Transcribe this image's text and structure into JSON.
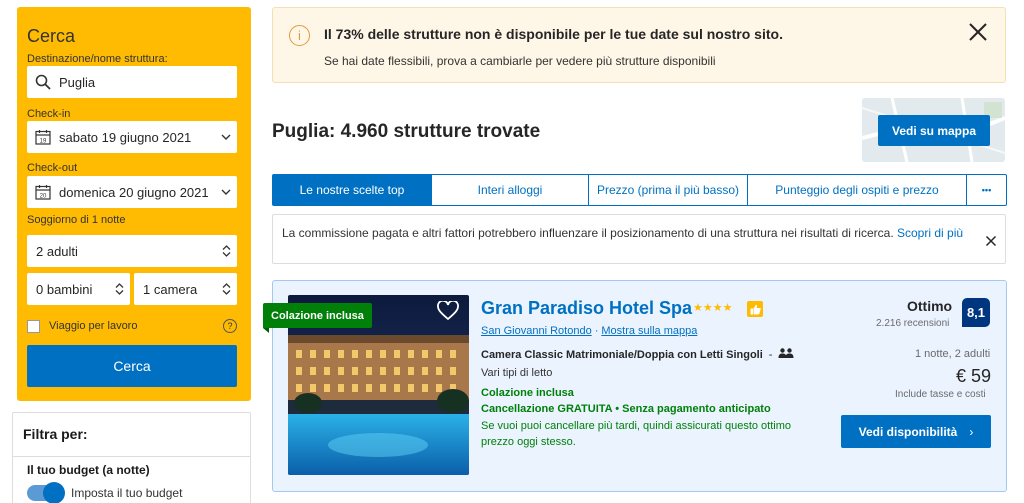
{
  "search": {
    "title": "Cerca",
    "destination_label": "Destinazione/nome struttura:",
    "destination_value": "Puglia",
    "checkin_label": "Check-in",
    "checkin_value": "sabato 19 giugno 2021",
    "checkin_icon_day": "19",
    "checkout_label": "Check-out",
    "checkout_value": "domenica 20 giugno 2021",
    "checkout_icon_day": "20",
    "stay_label": "Soggiorno di 1 notte",
    "adults": "2 adulti",
    "children": "0 bambini",
    "rooms": "1 camera",
    "work_travel_label": "Viaggio per lavoro",
    "help_icon": "?",
    "button_label": "Cerca"
  },
  "filters": {
    "title": "Filtra per:",
    "budget_title": "Il tuo budget (a notte)",
    "budget_toggle_label": "Imposta il tuo budget"
  },
  "alert": {
    "icon": "i",
    "title": "Il 73% delle strutture non è disponibile per le tue date sul nostro sito.",
    "text": "Se hai date flessibili, prova a cambiarle per vedere più strutture disponibili"
  },
  "results": {
    "title": "Puglia: 4.960 strutture trovate",
    "map_button": "Vedi su mappa"
  },
  "tabs": [
    {
      "label": "Le nostre scelte top",
      "active": true
    },
    {
      "label": "Interi alloggi",
      "active": false
    },
    {
      "label": "Prezzo (prima il più basso)",
      "active": false
    },
    {
      "label": "Punteggio degli ospiti e prezzo",
      "active": false
    },
    {
      "label": "•••",
      "active": false
    }
  ],
  "note": {
    "text": "La commissione pagata e altri fattori potrebbero influenzare il posizionamento di una struttura nei risultati di ricerca.",
    "link": "Scopri di più"
  },
  "property": {
    "badge": "Colazione inclusa",
    "name": "Gran Paradiso Hotel Spa",
    "stars": "★★★★",
    "location": "San Giovanni Rotondo",
    "location_separator": "·",
    "map_link": "Mostra sulla mappa",
    "room_type": "Camera Classic Matrimoniale/Doppia con Letti Singoli",
    "room_dash": "-",
    "beds": "Vari tipi di letto",
    "breakfast": "Colazione inclusa",
    "cancellation": "Cancellazione GRATUITA • Senza pagamento anticipato",
    "cancellation_note": "Se vuoi puoi cancellare più tardi, quindi assicurati questo ottimo prezzo oggi stesso.",
    "rating_word": "Ottimo",
    "reviews": "2.216 recensioni",
    "score": "8,1",
    "nights_guests": "1 notte, 2 adulti",
    "price": "€ 59",
    "taxes": "Include tasse e costi",
    "button": "Vedi disponibilità",
    "button_arrow": "›"
  },
  "colors": {
    "brand_blue": "#0071c2",
    "search_yellow": "#febb02",
    "green": "#008009",
    "score_blue": "#003580"
  }
}
